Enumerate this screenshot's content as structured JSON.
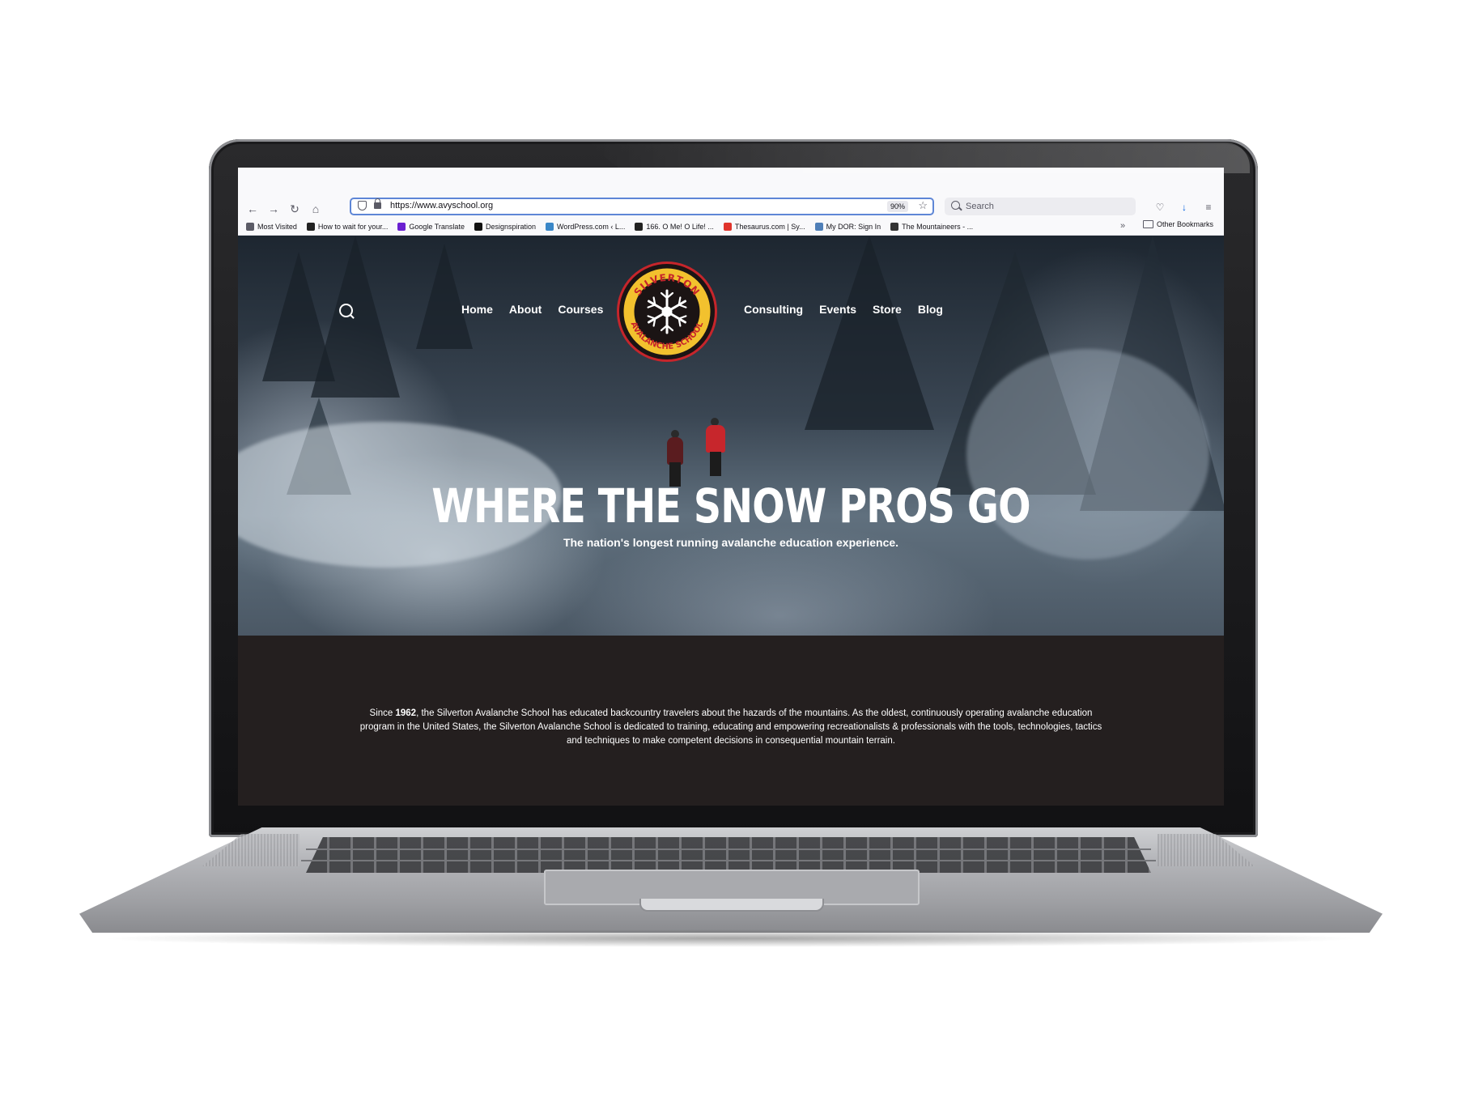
{
  "browser": {
    "url": "https://www.avyschool.org",
    "zoom": "90%",
    "search_placeholder": "Search",
    "bookmarks": [
      {
        "label": "Most Visited",
        "color": "#5b5b66"
      },
      {
        "label": "How to wait for your...",
        "color": "#222222"
      },
      {
        "label": "Google Translate",
        "color": "#6a1fd1"
      },
      {
        "label": "Designspiration",
        "color": "#111111"
      },
      {
        "label": "WordPress.com ‹ L...",
        "color": "#3a87c8"
      },
      {
        "label": "166. O Me! O Life! ...",
        "color": "#222222"
      },
      {
        "label": "Thesaurus.com | Sy...",
        "color": "#e0342c"
      },
      {
        "label": "My DOR: Sign In",
        "color": "#4f7fb8"
      },
      {
        "label": "The Mountaineers - ...",
        "color": "#333333"
      }
    ],
    "other_bookmarks": "Other Bookmarks"
  },
  "site": {
    "nav_left": [
      "Home",
      "About",
      "Courses"
    ],
    "nav_right": [
      "Consulting",
      "Events",
      "Store",
      "Blog"
    ],
    "logo": {
      "top_text": "SILVERTON",
      "bottom_text": "AVALANCHE SCHOOL"
    },
    "headline": "WHERE THE SNOW PROS GO",
    "subline": "The nation's longest running avalanche education experience.",
    "about": {
      "prefix": "Since ",
      "year": "1962",
      "text": ", the Silverton Avalanche School has educated backcountry travelers about the hazards of the mountains. As the oldest, continuously operating avalanche education program in the United States, the Silverton Avalanche School is dedicated to training, educating and empowering recreationalists & professionals with the tools, technologies, tactics and techniques to make competent decisions in consequential mountain terrain."
    }
  },
  "colors": {
    "accent_red": "#c6252b",
    "logo_yellow": "#f2c12e",
    "footer_bg": "#241f1f"
  }
}
